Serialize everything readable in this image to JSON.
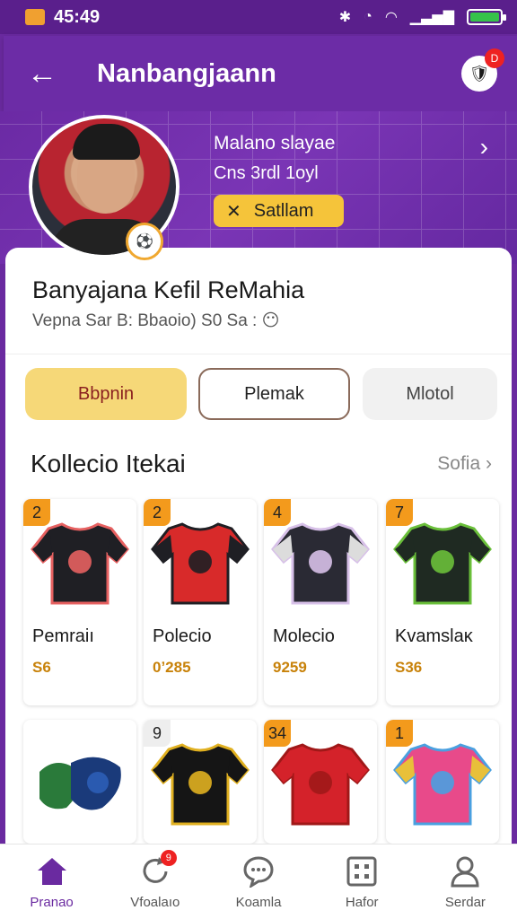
{
  "status_bar": {
    "time": "45:49",
    "battery_level": 1.0
  },
  "app_bar": {
    "title": "Nanbangjaann",
    "notification_badge": "D"
  },
  "hero": {
    "name": "Malano slayae",
    "sub": "Cns 3rdl 1oyl",
    "status_label": "Satllam"
  },
  "profile": {
    "name": "Banyajana Kefil ReMahia",
    "meta": "Vepna Sar B: Bbaoio) S0 Sa :"
  },
  "buttons": [
    "Bbpnin",
    "Plemak",
    "Mlotol"
  ],
  "section": {
    "title": "Kollecio Itekai",
    "see_all": "Sofia"
  },
  "cards": [
    {
      "qty": "2",
      "name": "Pemraiı",
      "price": "S6",
      "colors": {
        "body": "#1f1f24",
        "trim": "#e66060",
        "sleeve": "#1f1f24"
      }
    },
    {
      "qty": "2",
      "name": "Polecio",
      "price": "0ʼ285",
      "colors": {
        "body": "#d82a2a",
        "trim": "#1f1f24",
        "sleeve": "#1f1f24"
      }
    },
    {
      "qty": "4",
      "name": "Molecio",
      "price": "9259",
      "colors": {
        "body": "#2a2a34",
        "trim": "#d7c0e8",
        "sleeve": "#dcdcdc"
      }
    },
    {
      "qty": "7",
      "name": "Kvamslaκ",
      "price": "S36",
      "colors": {
        "body": "#1f2a22",
        "trim": "#6abf3a",
        "sleeve": "#1f2a22"
      }
    },
    {
      "qty": "",
      "name": "",
      "price": "",
      "colors": {
        "body": "#2a7a3a",
        "trim": "#2a5ab0",
        "sleeve": "#1a3a7a"
      }
    },
    {
      "qty": "9",
      "name": "",
      "price": "",
      "colors": {
        "body": "#151515",
        "trim": "#e0b020",
        "sleeve": "#151515"
      }
    },
    {
      "qty": "34",
      "name": "",
      "price": "",
      "colors": {
        "body": "#d4222a",
        "trim": "#a01818",
        "sleeve": "#d4222a"
      }
    },
    {
      "qty": "1",
      "name": "",
      "price": "",
      "colors": {
        "body": "#e84a8a",
        "trim": "#4aa0e0",
        "sleeve": "#e8c03a"
      }
    }
  ],
  "nav": [
    {
      "label": "Pranao",
      "icon": "home-icon",
      "active": true
    },
    {
      "label": "Vfoalaıo",
      "icon": "refresh-icon",
      "badge": "9"
    },
    {
      "label": "Koamla",
      "icon": "chat-icon"
    },
    {
      "label": "Hafor",
      "icon": "grid-icon"
    },
    {
      "label": "Serdar",
      "icon": "profile-icon"
    }
  ],
  "colors": {
    "primary": "#6a2aa0",
    "accent": "#f5c43a",
    "price": "#c8820a",
    "badge": "#f39a1c"
  }
}
